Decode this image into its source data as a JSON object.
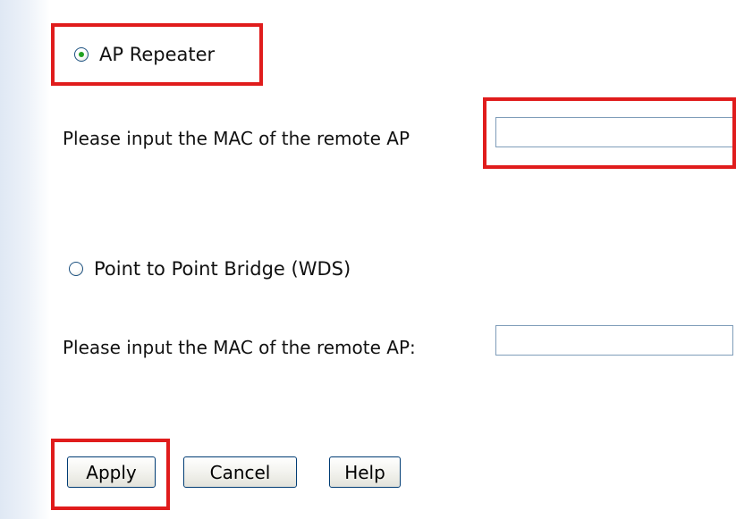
{
  "mode_options": {
    "ap_repeater": {
      "label": "AP Repeater",
      "checked": true
    },
    "wds_bridge": {
      "label": "Point to Point Bridge (WDS)",
      "checked": false
    }
  },
  "ap_repeater_mac": {
    "label": "Please input the MAC of the remote AP",
    "value": "",
    "placeholder": ""
  },
  "wds_mac": {
    "label": "Please input the MAC of the remote AP:",
    "value": "",
    "placeholder": ""
  },
  "buttons": {
    "apply": "Apply",
    "cancel": "Cancel",
    "help": "Help"
  },
  "annotation_color": "#e01c1c"
}
